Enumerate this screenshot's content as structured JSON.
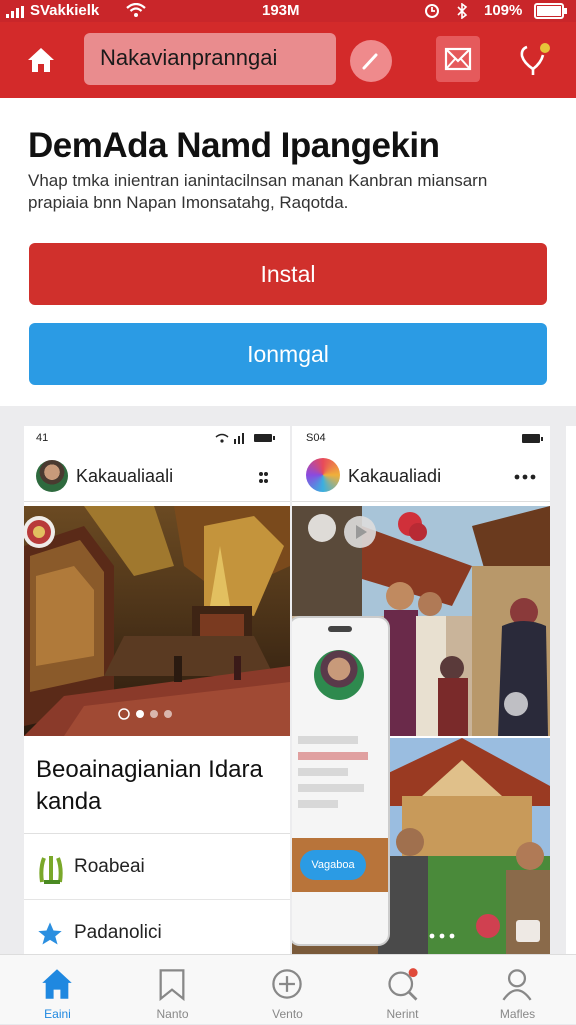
{
  "status_bar": {
    "carrier": "SVakkielk",
    "time": "193M",
    "battery": "109%"
  },
  "header": {
    "search_value": "Nakavianpranngai",
    "colors": {
      "bar": "#d32a2a",
      "status": "#c9262a"
    }
  },
  "hero": {
    "title": "DemAda Namd Ipangekin",
    "description": "Vhap tmka inientran ianintacilnsan manan Kanbran miansarn prapiaia bnn Napan Imonsatahg, Raqotda.",
    "install_label": "Instal",
    "open_label": "Ionmgal",
    "colors": {
      "install": "#d0302c",
      "open": "#2b9be4"
    }
  },
  "screenshots": {
    "left": {
      "status_time": "41",
      "profile_name": "Kakaualiaali",
      "menu_icon": "more-vertical-icon",
      "caption": "Beoainagianian Idara kanda",
      "items": [
        {
          "label": "Roabeai",
          "icon": "grain-icon"
        },
        {
          "label": "Padanolici",
          "icon": "star-icon"
        }
      ]
    },
    "right": {
      "status_time": "S04",
      "profile_name": "Kakaualiadi",
      "menu_icon": "more-horizontal-icon",
      "overlay_button": "Vagaboa"
    }
  },
  "bottom_nav": {
    "items": [
      {
        "label": "Eaini",
        "icon": "home-icon",
        "active": true
      },
      {
        "label": "Nanto",
        "icon": "bookmark-icon",
        "active": false
      },
      {
        "label": "Vento",
        "icon": "plus-circle-icon",
        "active": false
      },
      {
        "label": "Nerint",
        "icon": "search-notification-icon",
        "active": false
      },
      {
        "label": "Mafles",
        "icon": "profile-icon",
        "active": false
      }
    ],
    "active_color": "#1f88e0"
  }
}
